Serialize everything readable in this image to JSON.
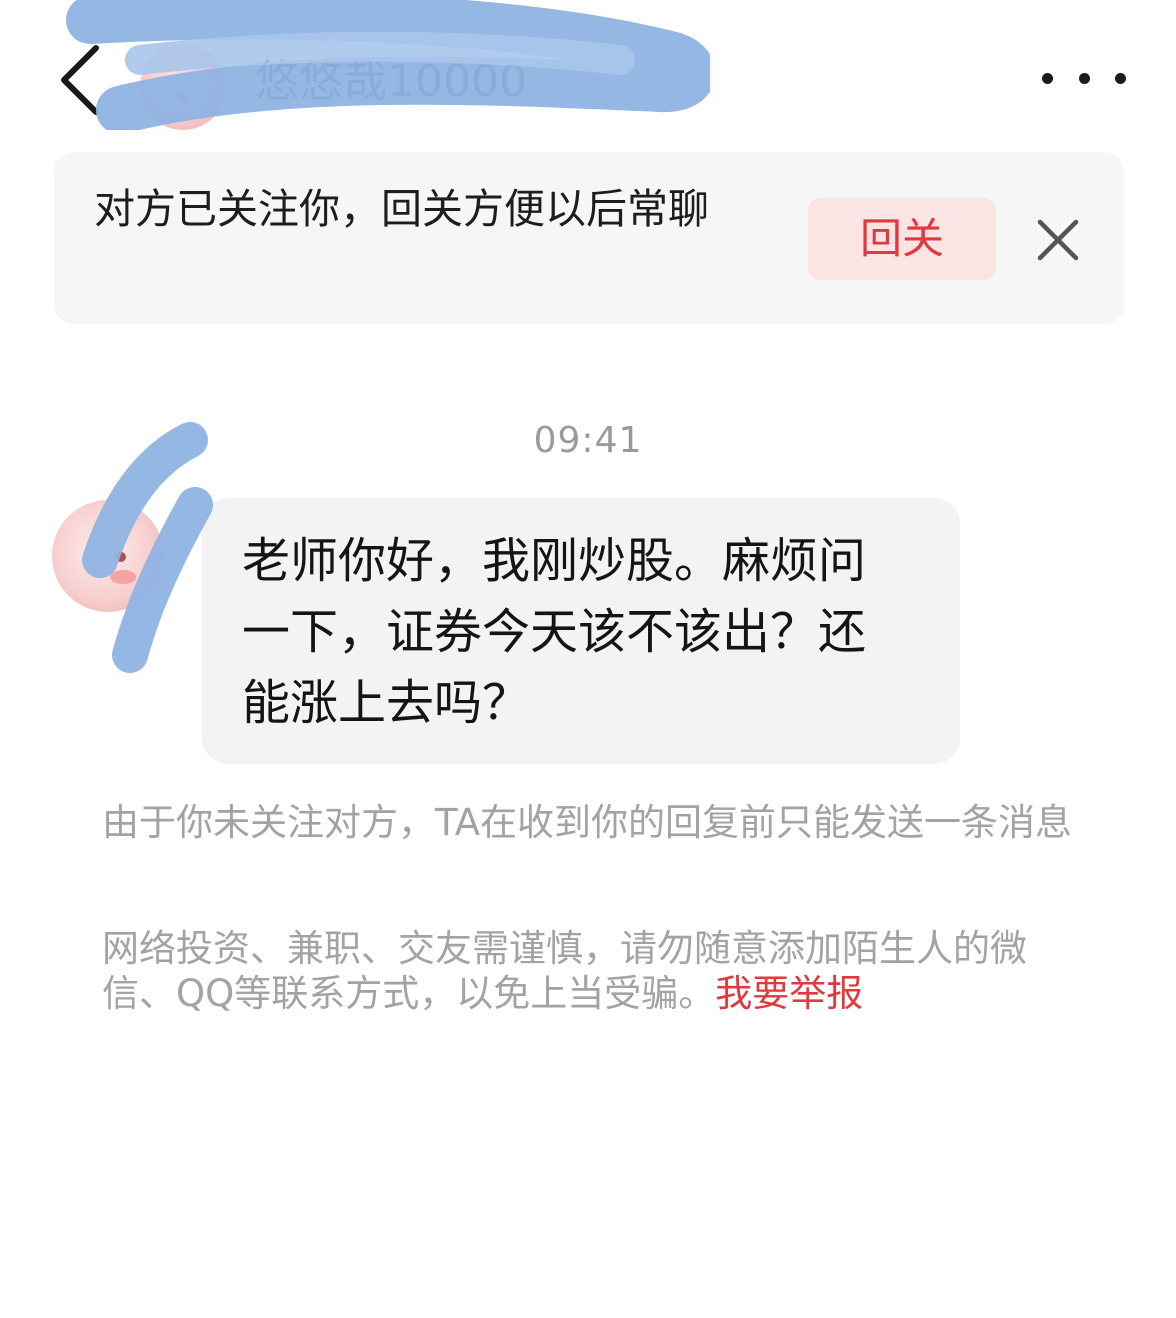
{
  "header": {
    "name": "悠悠哉10000",
    "back_icon": "chevron-left-icon",
    "more_icon": "more-dots-icon"
  },
  "follow_banner": {
    "text": "对方已关注你，回关方便以后常聊",
    "button_label": "回关",
    "close_icon": "close-icon",
    "button_color": "#e0393e",
    "button_bg": "#fbe4e4"
  },
  "chat": {
    "timestamp": "09:41",
    "messages": [
      {
        "sender": "other",
        "text": "老师你好，我刚炒股。麻烦问一下，证券今天该不该出？还能涨上去吗？"
      }
    ]
  },
  "notices": {
    "limit_notice": "由于你未关注对方，TA在收到你的回复前只能发送一条消息",
    "safety_notice": "网络投资、兼职、交友需谨慎，请勿随意添加陌生人的微信、QQ等联系方式，以免上当受骗。",
    "report_link": "我要举报",
    "link_color": "#e0393e"
  },
  "colors": {
    "redaction": "#8fb3e3",
    "banner_bg": "#f6f6f7",
    "bubble_bg": "#f3f3f5"
  }
}
